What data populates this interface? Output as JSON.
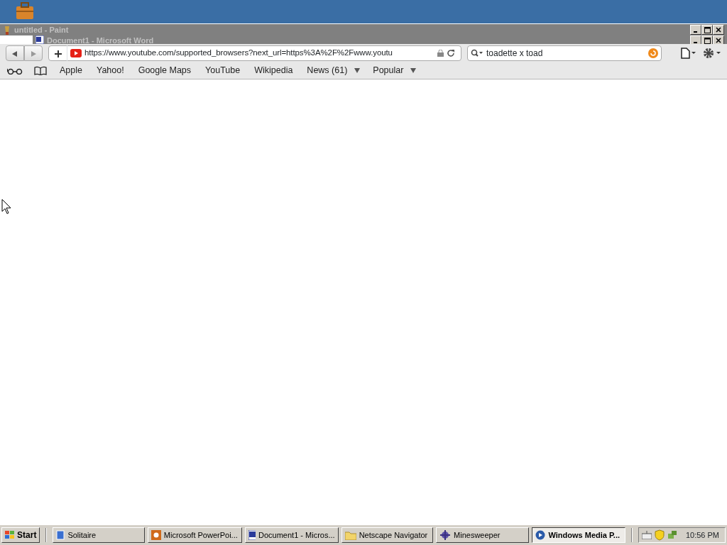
{
  "background_windows": [
    {
      "title": "untitled - Paint",
      "kind": "paint"
    },
    {
      "title": "Document1 - Microsoft Word",
      "kind": "word"
    }
  ],
  "browser": {
    "url": "https://www.youtube.com/supported_browsers?next_url=https%3A%2F%2Fwww.youtu",
    "search": "toadette x toad",
    "bookmarks": [
      {
        "label": "Apple",
        "menu": false
      },
      {
        "label": "Yahoo!",
        "menu": false
      },
      {
        "label": "Google Maps",
        "menu": false
      },
      {
        "label": "YouTube",
        "menu": false
      },
      {
        "label": "Wikipedia",
        "menu": false
      },
      {
        "label": "News (61)",
        "menu": true
      },
      {
        "label": "Popular",
        "menu": true
      }
    ]
  },
  "taskbar": {
    "start": "Start",
    "tasks": [
      {
        "label": "Solitaire",
        "kind": "solitaire",
        "selected": false
      },
      {
        "label": "Microsoft PowerPoi...",
        "kind": "powerpoint",
        "selected": false
      },
      {
        "label": "Document1 - Micros...",
        "kind": "word",
        "selected": false
      },
      {
        "label": "Netscape Navigator",
        "kind": "folder",
        "selected": false
      },
      {
        "label": "Minesweeper",
        "kind": "minesweeper",
        "selected": false
      },
      {
        "label": "Windows Media P...",
        "kind": "media",
        "selected": true
      }
    ],
    "clock": "10:56 PM"
  }
}
